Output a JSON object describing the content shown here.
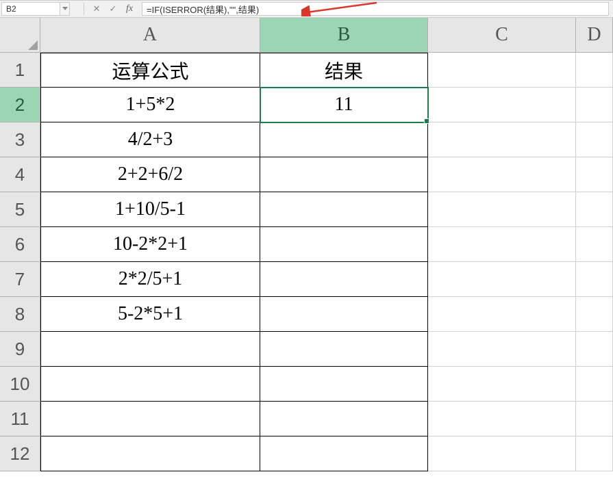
{
  "formula_bar": {
    "name_box": "B2",
    "cancel_symbol": "✕",
    "enter_symbol": "✓",
    "fx_symbol": "fx",
    "formula": "=IF(ISERROR(结果),\"\",结果)"
  },
  "columns": [
    "A",
    "B",
    "C",
    "D"
  ],
  "selected_column_index": 1,
  "rows": [
    "1",
    "2",
    "3",
    "4",
    "5",
    "6",
    "7",
    "8",
    "9",
    "10",
    "11",
    "12"
  ],
  "selected_row_index": 1,
  "active_cell": {
    "row": 2,
    "col": "B"
  },
  "grid": {
    "bordered_rows": 12,
    "headers": {
      "A": "运算公式",
      "B": "结果"
    },
    "data": [
      {
        "A": "1+5*2",
        "B": "11"
      },
      {
        "A": "4/2+3",
        "B": ""
      },
      {
        "A": "2+2+6/2",
        "B": ""
      },
      {
        "A": "1+10/5-1",
        "B": ""
      },
      {
        "A": "10-2*2+1",
        "B": ""
      },
      {
        "A": "2*2/5+1",
        "B": ""
      },
      {
        "A": "5-2*5+1",
        "B": ""
      },
      {
        "A": "",
        "B": ""
      },
      {
        "A": "",
        "B": ""
      },
      {
        "A": "",
        "B": ""
      },
      {
        "A": "",
        "B": ""
      }
    ]
  },
  "arrow_color": "#d9372b"
}
